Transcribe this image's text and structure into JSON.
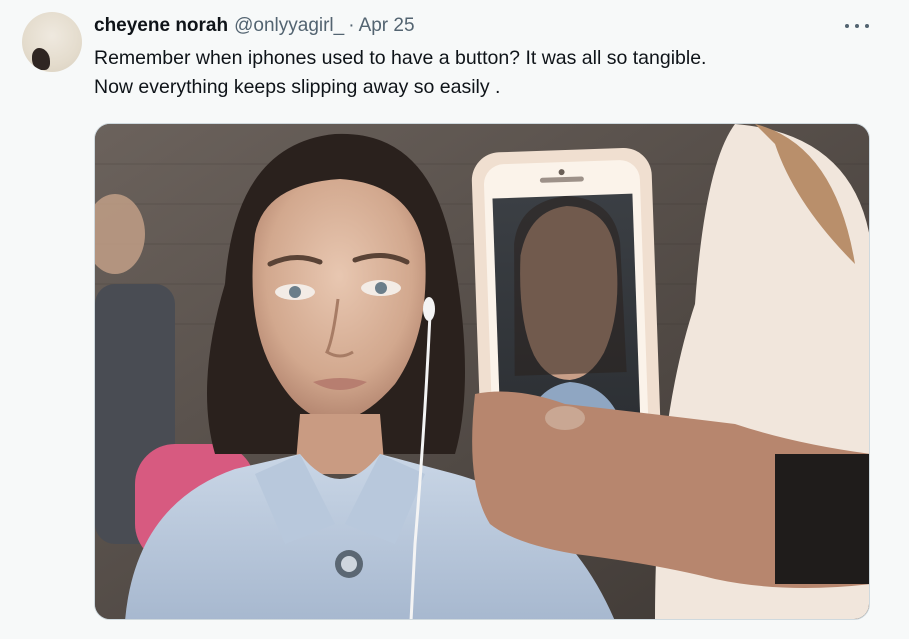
{
  "tweet": {
    "display_name": "cheyene norah",
    "handle": "@onlyyagirl_",
    "separator": "·",
    "date": "Apr 25",
    "text_lines": [
      "Remember when iphones used to have a button? It was all so tangible.",
      "Now everything keeps slipping away so easily ."
    ]
  },
  "icons": {
    "more": "more-horizontal-icon",
    "avatar": "user-avatar"
  },
  "media": {
    "description": "photo"
  },
  "colors": {
    "background": "#f7f9f9",
    "text_primary": "#0f1419",
    "text_secondary": "#536471",
    "border": "#cfd9de"
  }
}
